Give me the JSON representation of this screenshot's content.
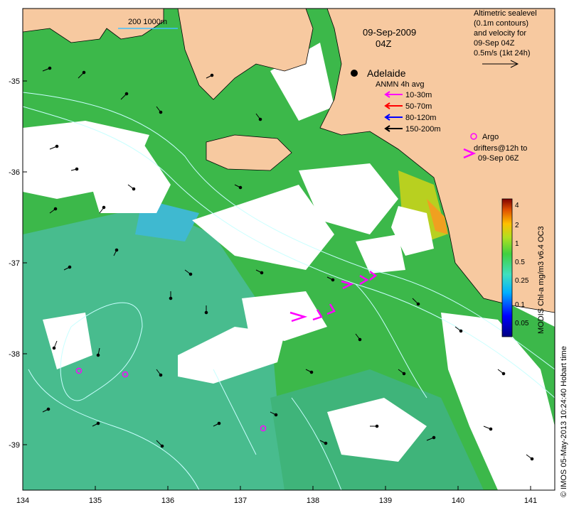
{
  "map": {
    "date": "09-Sep-2009",
    "time": "04Z",
    "scale_label": "200  1000m",
    "city": "Adelaide",
    "x_ticks": [
      "134",
      "135",
      "136",
      "137",
      "138",
      "139",
      "140",
      "141"
    ],
    "y_ticks": [
      "-35",
      "-36",
      "-37",
      "-38",
      "-39"
    ]
  },
  "legend": {
    "sealevel_title": [
      "Altimetric sealevel",
      "(0.1m contours)",
      "and velocity for",
      "09-Sep 04Z",
      "0.5m/s (1kt 24h)"
    ],
    "anmn_title": "ANMN 4h avg",
    "anmn_items": [
      {
        "label": "10-30m",
        "color": "#ff00ff"
      },
      {
        "label": "50-70m",
        "color": "#ff0000"
      },
      {
        "label": "80-120m",
        "color": "#0000ff"
      },
      {
        "label": "150-200m",
        "color": "#000000"
      }
    ],
    "argo_label": "Argo",
    "drifters_label": [
      "drifters@12h to",
      "09-Sep 06Z"
    ]
  },
  "colorbar": {
    "title": "MODIS Chl-a mg/m3 v6.4 OC3",
    "ticks": [
      "4",
      "2",
      "1",
      "0.5",
      "0.25",
      "0.1",
      "0.05"
    ]
  },
  "credit": "© IMOS 05-May-2013 10:24:40 Hobart time",
  "colors": {
    "land": "#f7c9a0",
    "ocean_green": "#3cb84a",
    "ocean_teal": "#45c0a0",
    "cloud": "#ffffff",
    "contour": "#b8ffff",
    "argo": "#ff00ff"
  }
}
